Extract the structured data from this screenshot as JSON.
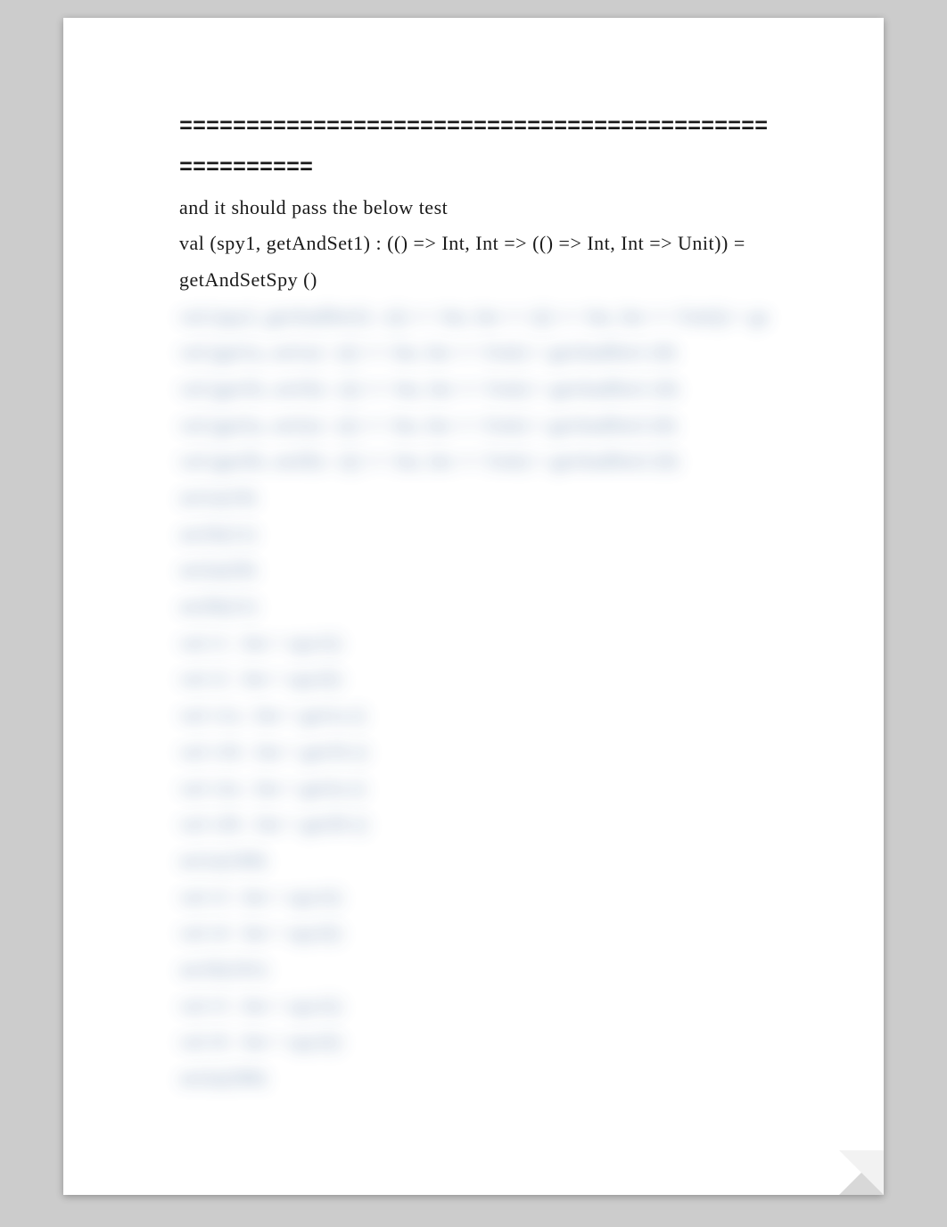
{
  "lines": {
    "divider1": "=============================================",
    "divider2": "==========",
    "sharp1": "and it should pass the below test",
    "sharp2": "val (spy1, getAndSet1) : (() => Int, Int => (() => Int, Int => Unit)) = getAndSetSpy ()"
  },
  "blurred": [
    " val (spy2, getAndSet2) : (() => Int, Int => (() => Int, Int => Unit)) = getAndSetSpy ()",
    " val (get1a, set1a) : (() => Int, Int => Unit) = getAndSet1 (0)",
    " val (get1b, set1b) : (() => Int, Int => Unit) = getAndSet1 (0)",
    " val (get2a, set2a) : (() => Int, Int => Unit) = getAndSet2 (0)",
    " val (get2b, set2b) : (() => Int, Int => Unit) = getAndSet2 (0)",
    " set1a(10)",
    " set1b(11)",
    " set2a(20)",
    " set2b(21)",
    " val r1 : Int = spy1()",
    " val r2 : Int = spy2()",
    " val v1a : Int = get1a ()",
    " val v1b : Int = get1b ()",
    " val v2a : Int = get2a ()",
    " val v2b : Int = get2b ()",
    " set1a(100)",
    " val r3 : Int = spy1()",
    " val r4 : Int = spy2()",
    " set1b(101)",
    " val r5 : Int = spy1()",
    " val r6 : Int = spy2()",
    " set2a(200)"
  ]
}
